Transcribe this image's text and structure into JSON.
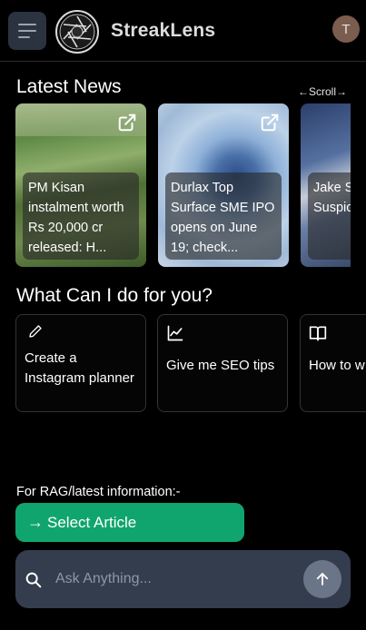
{
  "header": {
    "brand": "StreakLens",
    "avatar_initial": "T",
    "menu_icon": "hamburger-icon",
    "logo_icon": "camera-aperture-logo"
  },
  "news": {
    "title": "Latest News",
    "scroll_hint": "←Scroll→",
    "items": [
      {
        "title": "PM Kisan instalment worth Rs 20,000 cr released: H..."
      },
      {
        "title": "Durlax Top Surface SME IPO opens on June 19; check..."
      },
      {
        "title": "Jake S India w Suspic uncert"
      }
    ]
  },
  "help": {
    "title": "What Can I do for you?",
    "tasks": [
      {
        "label": "Create a Instagram planner",
        "icon": "pencil-icon"
      },
      {
        "label": "Give me SEO tips",
        "icon": "trend-chart-icon"
      },
      {
        "label": "How to w blog",
        "icon": "book-open-icon"
      }
    ]
  },
  "rag": {
    "label": "For RAG/latest information:-",
    "button_label": "Select Article",
    "button_arrow": "→"
  },
  "ask": {
    "placeholder": "Ask Anything..."
  },
  "colors": {
    "accent_green": "#10a56f",
    "ask_bar": "#343d4d",
    "avatar": "#7a5d4f"
  }
}
